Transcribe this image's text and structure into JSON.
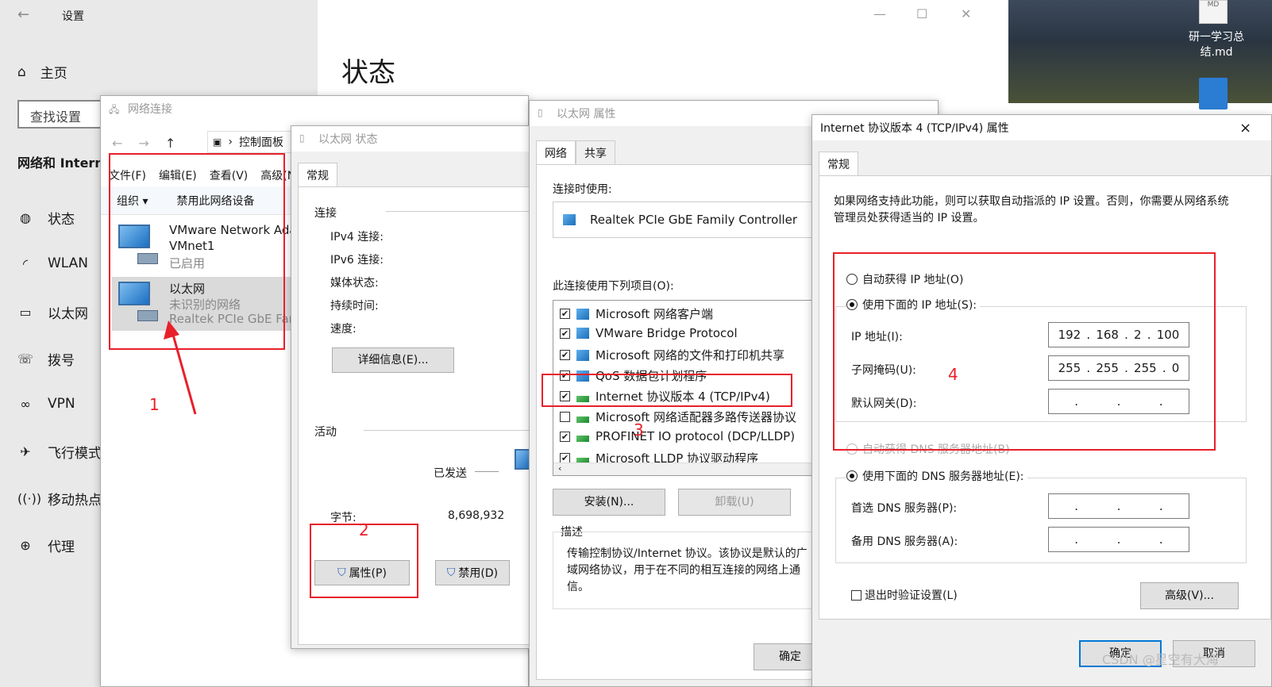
{
  "settings": {
    "title": "设置",
    "home": "主页",
    "search_placeholder": "查找设置",
    "section": "网络和 Intern",
    "page_title": "状态",
    "nav": [
      "状态",
      "WLAN",
      "以太网",
      "拨号",
      "VPN",
      "飞行模式",
      "移动热点",
      "代理"
    ]
  },
  "desktop": {
    "file_name": "研一学习总结.md",
    "file_badge": "MD"
  },
  "netconn": {
    "title": "网络连接",
    "breadcrumb": "控制面板",
    "menu": [
      "文件(F)",
      "编辑(E)",
      "查看(V)",
      "高级(N"
    ],
    "toolbar": {
      "organize": "组织 ▾",
      "disable": "禁用此网络设备"
    },
    "items": [
      {
        "name": "VMware Network Ada",
        "line2": "VMnet1",
        "status": "已启用"
      },
      {
        "name": "以太网",
        "line2": "未识别的网络",
        "status": "Realtek PCIe GbE Fam"
      }
    ]
  },
  "ethstatus": {
    "title": "以太网 状态",
    "tab": "常规",
    "conn_section": "连接",
    "ipv4": "IPv4 连接:",
    "ipv6": "IPv6 连接:",
    "media": "媒体状态:",
    "duration": "持续时间:",
    "speed": "速度:",
    "details_btn": "详细信息(E)...",
    "activity_section": "活动",
    "sent": "已发送",
    "bytes_label": "字节:",
    "bytes_value": "8,698,932",
    "properties_btn": "属性(P)",
    "disable_btn": "禁用(D)"
  },
  "ethprops": {
    "title": "以太网 属性",
    "tabs": [
      "网络",
      "共享"
    ],
    "connect_using": "连接时使用:",
    "adapter": "Realtek PCIe GbE Family Controller",
    "items_label": "此连接使用下列项目(O):",
    "items": [
      {
        "label": "Microsoft 网络客户端",
        "checked": "✔"
      },
      {
        "label": "VMware Bridge Protocol",
        "checked": "✔"
      },
      {
        "label": "Microsoft 网络的文件和打印机共享",
        "checked": "✔"
      },
      {
        "label": "QoS 数据包计划程序",
        "checked": "✔"
      },
      {
        "label": "Internet 协议版本 4 (TCP/IPv4)",
        "checked": "✔"
      },
      {
        "label": "Microsoft 网络适配器多路传送器协议",
        "checked": ""
      },
      {
        "label": "PROFINET IO protocol (DCP/LLDP)",
        "checked": "✔"
      },
      {
        "label": "Microsoft LLDP 协议驱动程序",
        "checked": "✔"
      }
    ],
    "install_btn": "安装(N)...",
    "uninstall_btn": "卸载(U)",
    "desc_label": "描述",
    "desc_text": "传输控制协议/Internet 协议。该协议是默认的广域网络协议，用于在不同的相互连接的网络上通信。",
    "ok_btn": "确定"
  },
  "ipv4": {
    "title": "Internet 协议版本 4 (TCP/IPv4) 属性",
    "tab": "常规",
    "intro": "如果网络支持此功能，则可以获取自动指派的 IP 设置。否则，你需要从网络系统管理员处获得适当的 IP 设置。",
    "auto_ip": "自动获得 IP 地址(O)",
    "manual_ip": "使用下面的 IP 地址(S):",
    "ip_label": "IP 地址(I):",
    "ip_value": [
      "192",
      "168",
      "2",
      "100"
    ],
    "mask_label": "子网掩码(U):",
    "mask_value": [
      "255",
      "255",
      "255",
      "0"
    ],
    "gateway_label": "默认网关(D):",
    "auto_dns": "自动获得 DNS 服务器地址(B)",
    "manual_dns": "使用下面的 DNS 服务器地址(E):",
    "dns1_label": "首选 DNS 服务器(P):",
    "dns2_label": "备用 DNS 服务器(A):",
    "validate": "退出时验证设置(L)",
    "advanced_btn": "高级(V)...",
    "ok_btn": "确定",
    "cancel_btn": "取消",
    "close": "×"
  },
  "annotations": [
    "1",
    "2",
    "3",
    "4"
  ],
  "watermark": "CSDN @星空有大海",
  "colors": {
    "annotation_red": "#e8202a",
    "accent_blue": "#0078d7"
  }
}
